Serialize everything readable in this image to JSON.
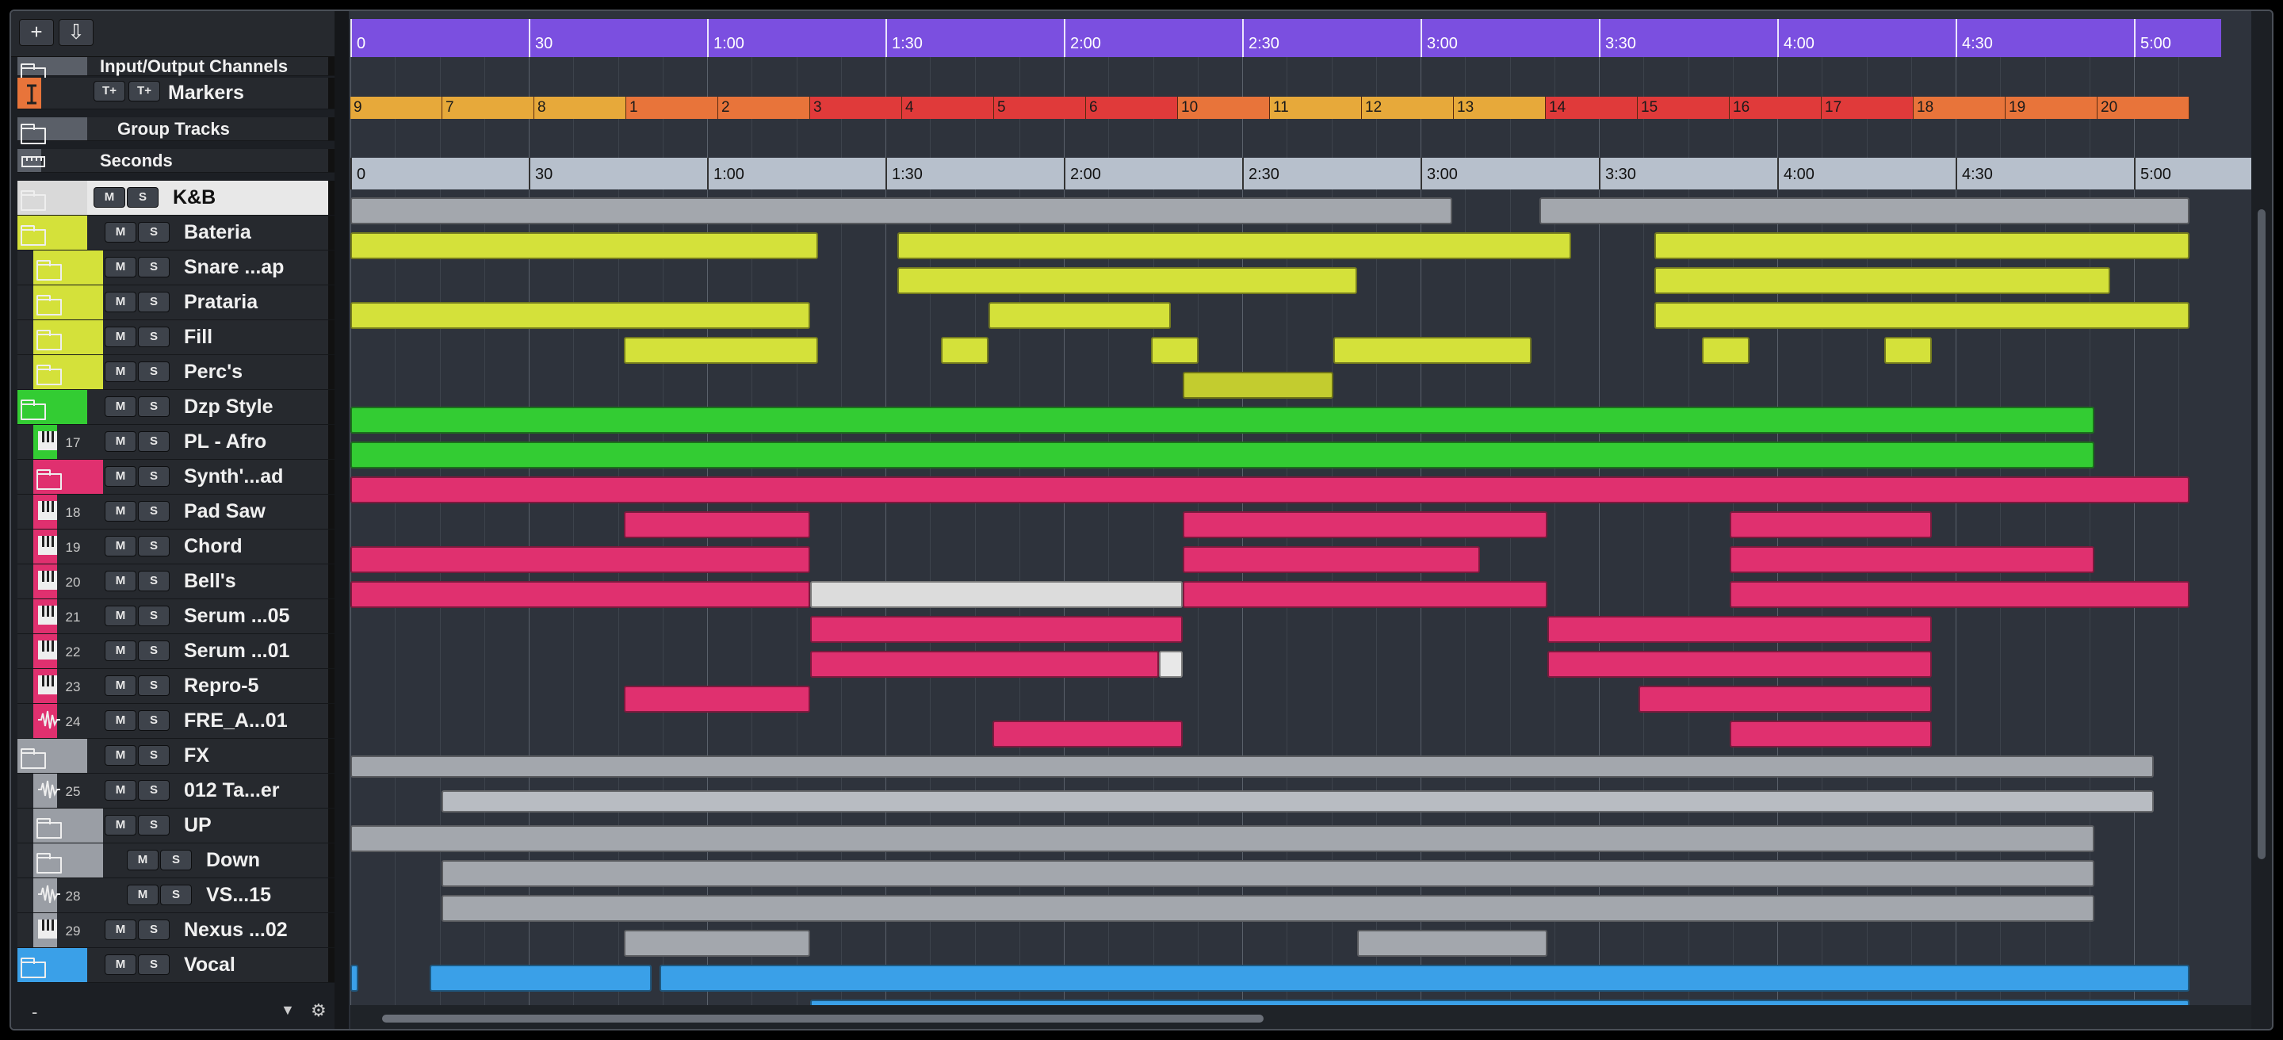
{
  "toolbar": {
    "add_label": "+",
    "load_label": "⇩"
  },
  "tracks": [
    {
      "name": "Input/Output Channels",
      "color": "#5a5f68",
      "kind": "folder",
      "num": "",
      "ms": false,
      "small": true
    },
    {
      "name": "Markers",
      "color": "#e8743a",
      "kind": "marker",
      "num": "",
      "ms": false,
      "small": false
    },
    {
      "name": "Group Tracks",
      "color": "#5a5f68",
      "kind": "folder",
      "num": "",
      "ms": false,
      "small": true
    },
    {
      "name": "Seconds",
      "color": "#5a5f68",
      "kind": "ruler",
      "num": "",
      "ms": false,
      "small": true
    },
    {
      "name": "K&B",
      "color": "#d9d9d9",
      "kind": "folder",
      "num": "",
      "ms": true,
      "small": false
    },
    {
      "name": "Bateria",
      "color": "#d4e13a",
      "kind": "folder",
      "num": "",
      "ms": true,
      "small": false
    },
    {
      "name": "Snare ...ap",
      "color": "#d4e13a",
      "kind": "folder",
      "num": "",
      "ms": true,
      "small": false
    },
    {
      "name": "Prataria",
      "color": "#d4e13a",
      "kind": "folder",
      "num": "",
      "ms": true,
      "small": false
    },
    {
      "name": "Fill",
      "color": "#d4e13a",
      "kind": "folder",
      "num": "",
      "ms": true,
      "small": false
    },
    {
      "name": "Perc's",
      "color": "#d4e13a",
      "kind": "folder",
      "num": "",
      "ms": true,
      "small": false
    },
    {
      "name": "Dzp Style",
      "color": "#33cc33",
      "kind": "folder",
      "num": "",
      "ms": true,
      "small": false
    },
    {
      "name": "PL - Afro",
      "color": "#33cc33",
      "kind": "midi",
      "num": "17",
      "ms": true,
      "small": false
    },
    {
      "name": "Synth'...ad",
      "color": "#e0306f",
      "kind": "folder",
      "num": "",
      "ms": true,
      "small": false
    },
    {
      "name": "Pad Saw",
      "color": "#e0306f",
      "kind": "midi",
      "num": "18",
      "ms": true,
      "small": false
    },
    {
      "name": "Chord",
      "color": "#e0306f",
      "kind": "midi",
      "num": "19",
      "ms": true,
      "small": false
    },
    {
      "name": "Bell's",
      "color": "#e0306f",
      "kind": "midi",
      "num": "20",
      "ms": true,
      "small": false
    },
    {
      "name": "Serum ...05",
      "color": "#e0306f",
      "kind": "midi",
      "num": "21",
      "ms": true,
      "small": false
    },
    {
      "name": "Serum ...01",
      "color": "#e0306f",
      "kind": "midi",
      "num": "22",
      "ms": true,
      "small": false
    },
    {
      "name": "Repro-5",
      "color": "#e0306f",
      "kind": "midi",
      "num": "23",
      "ms": true,
      "small": false
    },
    {
      "name": "FRE_A...01",
      "color": "#e0306f",
      "kind": "audio",
      "num": "24",
      "ms": true,
      "small": false
    },
    {
      "name": "FX",
      "color": "#9a9ea5",
      "kind": "folder",
      "num": "",
      "ms": true,
      "small": false
    },
    {
      "name": "012 Ta...er",
      "color": "#9a9ea5",
      "kind": "audio",
      "num": "25",
      "ms": true,
      "small": false
    },
    {
      "name": "UP",
      "color": "#9a9ea5",
      "kind": "folder",
      "num": "",
      "ms": true,
      "small": false
    },
    {
      "name": "Down",
      "color": "#9a9ea5",
      "kind": "folder",
      "num": "",
      "ms": true,
      "small": false
    },
    {
      "name": "VS...15",
      "color": "#9a9ea5",
      "kind": "audio",
      "num": "28",
      "ms": true,
      "small": false
    },
    {
      "name": "Nexus ...02",
      "color": "#9a9ea5",
      "kind": "midi",
      "num": "29",
      "ms": true,
      "small": false
    },
    {
      "name": "Vocal",
      "color": "#3aa0e8",
      "kind": "folder",
      "num": "",
      "ms": true,
      "small": false
    }
  ],
  "ruler_labels": [
    "0",
    "30",
    "1:00",
    "1:30",
    "2:00",
    "2:30",
    "3:00",
    "3:30",
    "4:00",
    "4:30",
    "5:00"
  ],
  "markers": [
    {
      "label": "9",
      "color": "#e7a93a"
    },
    {
      "label": "7",
      "color": "#e7a93a"
    },
    {
      "label": "8",
      "color": "#e7a93a"
    },
    {
      "label": "1",
      "color": "#e8743a"
    },
    {
      "label": "2",
      "color": "#e8743a"
    },
    {
      "label": "3",
      "color": "#e03a3a"
    },
    {
      "label": "4",
      "color": "#e03a3a"
    },
    {
      "label": "5",
      "color": "#e03a3a"
    },
    {
      "label": "6",
      "color": "#e03a3a"
    },
    {
      "label": "10",
      "color": "#e8743a"
    },
    {
      "label": "11",
      "color": "#e7a93a"
    },
    {
      "label": "12",
      "color": "#e7a93a"
    },
    {
      "label": "13",
      "color": "#e7a93a"
    },
    {
      "label": "14",
      "color": "#e03a3a"
    },
    {
      "label": "15",
      "color": "#e03a3a"
    },
    {
      "label": "16",
      "color": "#e03a3a"
    },
    {
      "label": "17",
      "color": "#e03a3a"
    },
    {
      "label": "18",
      "color": "#e8743a"
    },
    {
      "label": "19",
      "color": "#e8743a"
    },
    {
      "label": "20",
      "color": "#e8743a"
    }
  ],
  "footer": {
    "minus": "-",
    "chevron": "▼",
    "gear": "⚙"
  }
}
